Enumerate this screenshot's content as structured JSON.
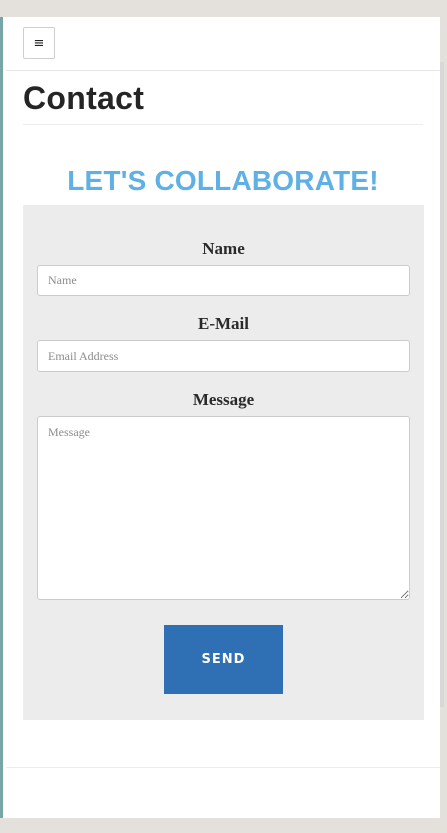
{
  "header": {
    "menu_icon": "hamburger-menu-icon",
    "menu_glyph": "≡"
  },
  "page": {
    "title": "Contact"
  },
  "hero": {
    "heading": "LET'S COLLABORATE!"
  },
  "form": {
    "name": {
      "label": "Name",
      "placeholder": "Name"
    },
    "email": {
      "label": "E-Mail",
      "placeholder": "Email Address"
    },
    "message": {
      "label": "Message",
      "placeholder": "Message"
    },
    "submit_label": "SEND"
  },
  "colors": {
    "accent_heading": "#5fb0e4",
    "button": "#2f6fb4",
    "panel": "#ececec",
    "page_bg": "#e4e1dd"
  }
}
